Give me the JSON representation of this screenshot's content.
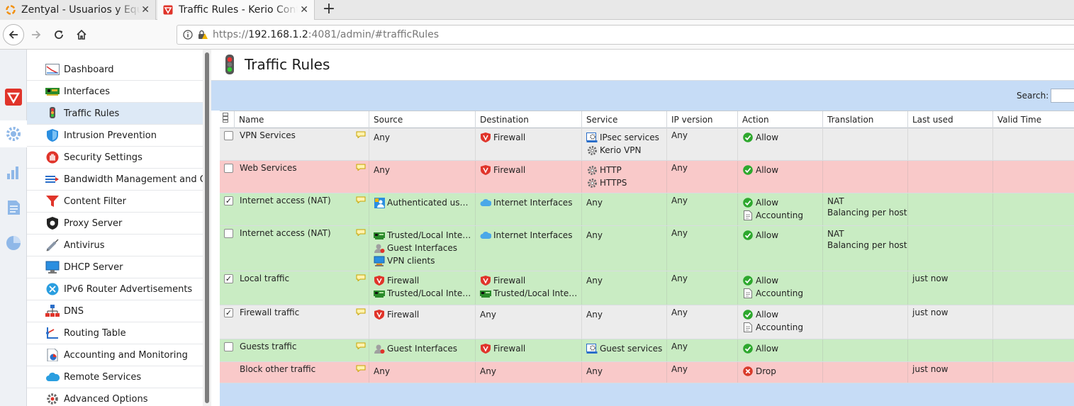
{
  "browser": {
    "tabs": [
      {
        "title": "Zentyal - Usuarios y Equipos",
        "active": false
      },
      {
        "title": "Traffic Rules - Kerio Control",
        "active": true
      }
    ],
    "url_scheme": "https://",
    "url_host": "192.168.1.2",
    "url_rest": ":4081/admin/#trafficRules"
  },
  "sidebar": {
    "items": [
      {
        "label": "Dashboard",
        "icon": "dashboard-icon"
      },
      {
        "label": "Interfaces",
        "icon": "network-card-icon"
      },
      {
        "label": "Traffic Rules",
        "icon": "traffic-light-icon",
        "active": true
      },
      {
        "label": "Intrusion Prevention",
        "icon": "shield-icon"
      },
      {
        "label": "Security Settings",
        "icon": "stop-hand-icon"
      },
      {
        "label": "Bandwidth Management and QoS",
        "icon": "bandwidth-icon"
      },
      {
        "label": "Content Filter",
        "icon": "funnel-icon"
      },
      {
        "label": "Proxy Server",
        "icon": "proxy-icon"
      },
      {
        "label": "Antivirus",
        "icon": "syringe-icon"
      },
      {
        "label": "DHCP Server",
        "icon": "monitor-icon"
      },
      {
        "label": "IPv6 Router Advertisements",
        "icon": "ipv6-icon"
      },
      {
        "label": "DNS",
        "icon": "dns-tree-icon"
      },
      {
        "label": "Routing Table",
        "icon": "routing-icon"
      },
      {
        "label": "Accounting and Monitoring",
        "icon": "accounting-icon"
      },
      {
        "label": "Remote Services",
        "icon": "cloud-icon"
      },
      {
        "label": "Advanced Options",
        "icon": "settings-gear-icon"
      }
    ]
  },
  "page": {
    "title": "Traffic Rules",
    "search_label": "Search:"
  },
  "table": {
    "columns": [
      "Name",
      "Source",
      "Destination",
      "Service",
      "IP version",
      "Action",
      "Translation",
      "Last used",
      "Valid Time"
    ],
    "rows": [
      {
        "checked": false,
        "color": "gray",
        "name": "VPN Services",
        "source": [
          {
            "text": "Any",
            "icon": ""
          }
        ],
        "destination": [
          {
            "text": "Firewall",
            "icon": "firewall"
          }
        ],
        "service": [
          {
            "text": "IPsec services",
            "icon": "service-group"
          },
          {
            "text": "Kerio VPN",
            "icon": "service"
          }
        ],
        "ipversion": "Any",
        "action": [
          {
            "text": "Allow",
            "icon": "allow"
          }
        ],
        "translation": [],
        "lastused": "",
        "validtime": ""
      },
      {
        "checked": false,
        "color": "red",
        "name": "Web Services",
        "source": [
          {
            "text": "Any",
            "icon": ""
          }
        ],
        "destination": [
          {
            "text": "Firewall",
            "icon": "firewall"
          }
        ],
        "service": [
          {
            "text": "HTTP",
            "icon": "service"
          },
          {
            "text": "HTTPS",
            "icon": "service"
          }
        ],
        "ipversion": "Any",
        "action": [
          {
            "text": "Allow",
            "icon": "allow"
          }
        ],
        "translation": [],
        "lastused": "",
        "validtime": ""
      },
      {
        "checked": true,
        "color": "green",
        "name": "Internet access (NAT)",
        "source": [
          {
            "text": "Authenticated users",
            "icon": "users"
          }
        ],
        "destination": [
          {
            "text": "Internet Interfaces",
            "icon": "internet"
          }
        ],
        "service": [
          {
            "text": "Any",
            "icon": ""
          }
        ],
        "ipversion": "Any",
        "action": [
          {
            "text": "Allow",
            "icon": "allow"
          },
          {
            "text": "Accounting",
            "icon": "accounting"
          }
        ],
        "translation": [
          "NAT",
          "Balancing per host"
        ],
        "lastused": "",
        "validtime": ""
      },
      {
        "checked": false,
        "color": "green",
        "name": "Internet access (NAT)",
        "source": [
          {
            "text": "Trusted/Local Interfaces",
            "icon": "trusted"
          },
          {
            "text": "Guest Interfaces",
            "icon": "guest"
          },
          {
            "text": "VPN clients",
            "icon": "vpn"
          }
        ],
        "destination": [
          {
            "text": "Internet Interfaces",
            "icon": "internet"
          }
        ],
        "service": [
          {
            "text": "Any",
            "icon": ""
          }
        ],
        "ipversion": "Any",
        "action": [
          {
            "text": "Allow",
            "icon": "allow"
          }
        ],
        "translation": [
          "NAT",
          "Balancing per host"
        ],
        "lastused": "",
        "validtime": ""
      },
      {
        "checked": true,
        "color": "green",
        "name": "Local traffic",
        "source": [
          {
            "text": "Firewall",
            "icon": "firewall"
          },
          {
            "text": "Trusted/Local Interfaces",
            "icon": "trusted"
          }
        ],
        "destination": [
          {
            "text": "Firewall",
            "icon": "firewall"
          },
          {
            "text": "Trusted/Local Interfaces",
            "icon": "trusted"
          }
        ],
        "service": [
          {
            "text": "Any",
            "icon": ""
          }
        ],
        "ipversion": "Any",
        "action": [
          {
            "text": "Allow",
            "icon": "allow"
          },
          {
            "text": "Accounting",
            "icon": "accounting"
          }
        ],
        "translation": [],
        "lastused": "just now",
        "validtime": ""
      },
      {
        "checked": true,
        "color": "gray",
        "name": "Firewall traffic",
        "source": [
          {
            "text": "Firewall",
            "icon": "firewall"
          }
        ],
        "destination": [
          {
            "text": "Any",
            "icon": ""
          }
        ],
        "service": [
          {
            "text": "Any",
            "icon": ""
          }
        ],
        "ipversion": "Any",
        "action": [
          {
            "text": "Allow",
            "icon": "allow"
          },
          {
            "text": "Accounting",
            "icon": "accounting"
          }
        ],
        "translation": [],
        "lastused": "just now",
        "validtime": ""
      },
      {
        "checked": false,
        "color": "green",
        "name": "Guests traffic",
        "source": [
          {
            "text": "Guest Interfaces",
            "icon": "guest"
          }
        ],
        "destination": [
          {
            "text": "Firewall",
            "icon": "firewall"
          }
        ],
        "service": [
          {
            "text": "Guest services",
            "icon": "service-group"
          }
        ],
        "ipversion": "Any",
        "action": [
          {
            "text": "Allow",
            "icon": "allow"
          }
        ],
        "translation": [],
        "lastused": "",
        "validtime": ""
      },
      {
        "checked": null,
        "color": "red",
        "name": "Block other traffic",
        "source": [
          {
            "text": "Any",
            "icon": ""
          }
        ],
        "destination": [
          {
            "text": "Any",
            "icon": ""
          }
        ],
        "service": [
          {
            "text": "Any",
            "icon": ""
          }
        ],
        "ipversion": "Any",
        "action": [
          {
            "text": "Drop",
            "icon": "drop"
          }
        ],
        "translation": [],
        "lastused": "just now",
        "validtime": ""
      }
    ]
  },
  "colors": {
    "row_gray": "#ececec",
    "row_red": "#f9c9c9",
    "row_green": "#c9ecc3",
    "toolbar_blue": "#c6dcf6",
    "allow_green": "#2ea82e",
    "drop_red": "#d83a2a",
    "firewall_red": "#e0342a"
  }
}
